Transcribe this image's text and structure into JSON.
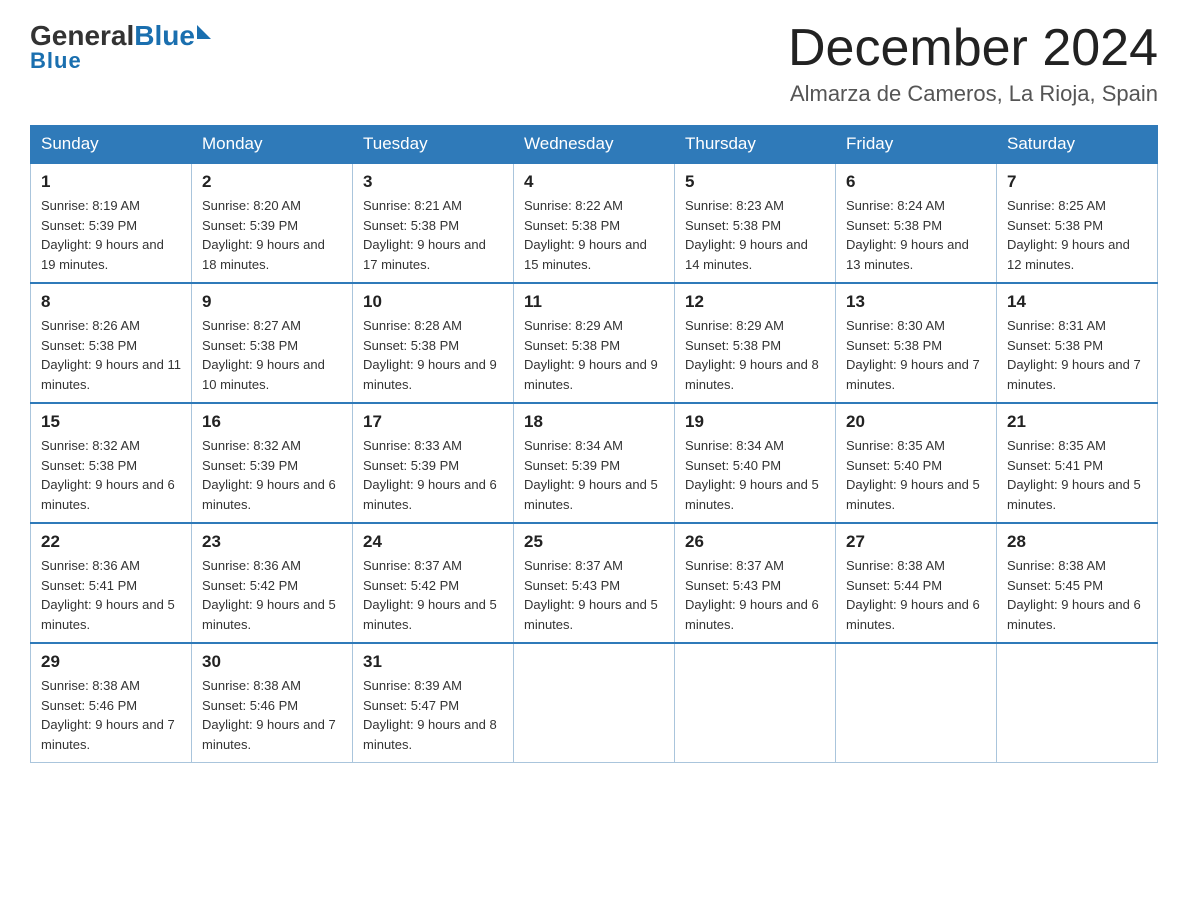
{
  "header": {
    "logo_general": "General",
    "logo_blue": "Blue",
    "month_title": "December 2024",
    "location": "Almarza de Cameros, La Rioja, Spain"
  },
  "weekdays": [
    "Sunday",
    "Monday",
    "Tuesday",
    "Wednesday",
    "Thursday",
    "Friday",
    "Saturday"
  ],
  "weeks": [
    [
      {
        "day": "1",
        "sunrise": "8:19 AM",
        "sunset": "5:39 PM",
        "daylight": "9 hours and 19 minutes."
      },
      {
        "day": "2",
        "sunrise": "8:20 AM",
        "sunset": "5:39 PM",
        "daylight": "9 hours and 18 minutes."
      },
      {
        "day": "3",
        "sunrise": "8:21 AM",
        "sunset": "5:38 PM",
        "daylight": "9 hours and 17 minutes."
      },
      {
        "day": "4",
        "sunrise": "8:22 AM",
        "sunset": "5:38 PM",
        "daylight": "9 hours and 15 minutes."
      },
      {
        "day": "5",
        "sunrise": "8:23 AM",
        "sunset": "5:38 PM",
        "daylight": "9 hours and 14 minutes."
      },
      {
        "day": "6",
        "sunrise": "8:24 AM",
        "sunset": "5:38 PM",
        "daylight": "9 hours and 13 minutes."
      },
      {
        "day": "7",
        "sunrise": "8:25 AM",
        "sunset": "5:38 PM",
        "daylight": "9 hours and 12 minutes."
      }
    ],
    [
      {
        "day": "8",
        "sunrise": "8:26 AM",
        "sunset": "5:38 PM",
        "daylight": "9 hours and 11 minutes."
      },
      {
        "day": "9",
        "sunrise": "8:27 AM",
        "sunset": "5:38 PM",
        "daylight": "9 hours and 10 minutes."
      },
      {
        "day": "10",
        "sunrise": "8:28 AM",
        "sunset": "5:38 PM",
        "daylight": "9 hours and 9 minutes."
      },
      {
        "day": "11",
        "sunrise": "8:29 AM",
        "sunset": "5:38 PM",
        "daylight": "9 hours and 9 minutes."
      },
      {
        "day": "12",
        "sunrise": "8:29 AM",
        "sunset": "5:38 PM",
        "daylight": "9 hours and 8 minutes."
      },
      {
        "day": "13",
        "sunrise": "8:30 AM",
        "sunset": "5:38 PM",
        "daylight": "9 hours and 7 minutes."
      },
      {
        "day": "14",
        "sunrise": "8:31 AM",
        "sunset": "5:38 PM",
        "daylight": "9 hours and 7 minutes."
      }
    ],
    [
      {
        "day": "15",
        "sunrise": "8:32 AM",
        "sunset": "5:38 PM",
        "daylight": "9 hours and 6 minutes."
      },
      {
        "day": "16",
        "sunrise": "8:32 AM",
        "sunset": "5:39 PM",
        "daylight": "9 hours and 6 minutes."
      },
      {
        "day": "17",
        "sunrise": "8:33 AM",
        "sunset": "5:39 PM",
        "daylight": "9 hours and 6 minutes."
      },
      {
        "day": "18",
        "sunrise": "8:34 AM",
        "sunset": "5:39 PM",
        "daylight": "9 hours and 5 minutes."
      },
      {
        "day": "19",
        "sunrise": "8:34 AM",
        "sunset": "5:40 PM",
        "daylight": "9 hours and 5 minutes."
      },
      {
        "day": "20",
        "sunrise": "8:35 AM",
        "sunset": "5:40 PM",
        "daylight": "9 hours and 5 minutes."
      },
      {
        "day": "21",
        "sunrise": "8:35 AM",
        "sunset": "5:41 PM",
        "daylight": "9 hours and 5 minutes."
      }
    ],
    [
      {
        "day": "22",
        "sunrise": "8:36 AM",
        "sunset": "5:41 PM",
        "daylight": "9 hours and 5 minutes."
      },
      {
        "day": "23",
        "sunrise": "8:36 AM",
        "sunset": "5:42 PM",
        "daylight": "9 hours and 5 minutes."
      },
      {
        "day": "24",
        "sunrise": "8:37 AM",
        "sunset": "5:42 PM",
        "daylight": "9 hours and 5 minutes."
      },
      {
        "day": "25",
        "sunrise": "8:37 AM",
        "sunset": "5:43 PM",
        "daylight": "9 hours and 5 minutes."
      },
      {
        "day": "26",
        "sunrise": "8:37 AM",
        "sunset": "5:43 PM",
        "daylight": "9 hours and 6 minutes."
      },
      {
        "day": "27",
        "sunrise": "8:38 AM",
        "sunset": "5:44 PM",
        "daylight": "9 hours and 6 minutes."
      },
      {
        "day": "28",
        "sunrise": "8:38 AM",
        "sunset": "5:45 PM",
        "daylight": "9 hours and 6 minutes."
      }
    ],
    [
      {
        "day": "29",
        "sunrise": "8:38 AM",
        "sunset": "5:46 PM",
        "daylight": "9 hours and 7 minutes."
      },
      {
        "day": "30",
        "sunrise": "8:38 AM",
        "sunset": "5:46 PM",
        "daylight": "9 hours and 7 minutes."
      },
      {
        "day": "31",
        "sunrise": "8:39 AM",
        "sunset": "5:47 PM",
        "daylight": "9 hours and 8 minutes."
      },
      null,
      null,
      null,
      null
    ]
  ]
}
